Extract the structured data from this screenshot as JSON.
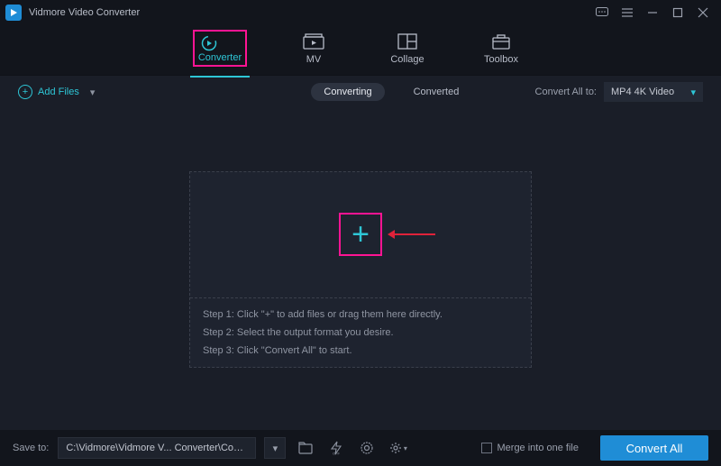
{
  "app": {
    "title": "Vidmore Video Converter"
  },
  "tabs": {
    "converter": "Converter",
    "mv": "MV",
    "collage": "Collage",
    "toolbox": "Toolbox"
  },
  "toolbar": {
    "add_files": "Add Files",
    "converting": "Converting",
    "converted": "Converted",
    "convert_all_to_label": "Convert All to:",
    "format_value": "MP4 4K Video"
  },
  "steps": {
    "s1": "Step 1: Click \"+\" to add files or drag them here directly.",
    "s2": "Step 2: Select the output format you desire.",
    "s3": "Step 3: Click \"Convert All\" to start."
  },
  "footer": {
    "save_to_label": "Save to:",
    "path": "C:\\Vidmore\\Vidmore V... Converter\\Converted",
    "merge_label": "Merge into one file",
    "convert_all_btn": "Convert All"
  }
}
